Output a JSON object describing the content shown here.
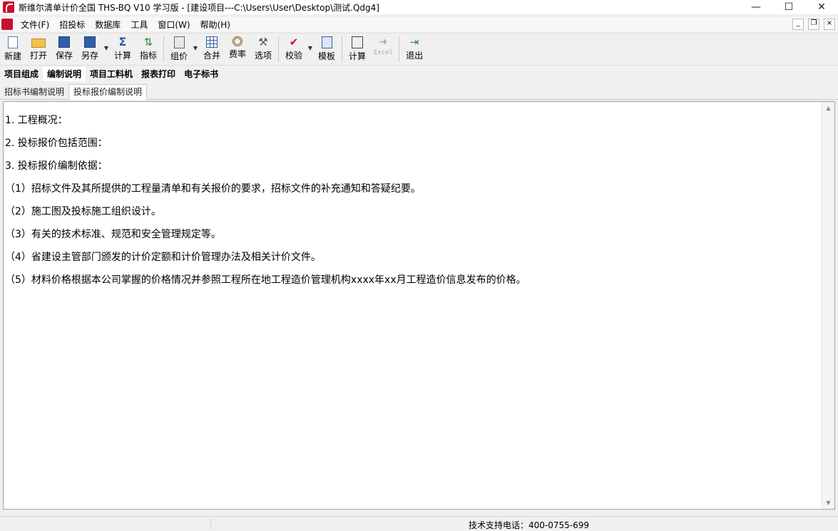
{
  "window": {
    "title": "斯维尔清单计价全国 THS-BQ V10 学习版 - [建设项目---C:\\Users\\User\\Desktop\\测试.Qdg4]",
    "minimize": "—",
    "maximize": "☐",
    "close": "✕"
  },
  "menu": {
    "items": [
      "文件(F)",
      "招投标",
      "数据库",
      "工具",
      "窗口(W)",
      "帮助(H)"
    ],
    "mdi_minimize": "_",
    "mdi_restore": "❐",
    "mdi_close": "×"
  },
  "toolbar": {
    "new": "新建",
    "open": "打开",
    "save": "保存",
    "save_as": "另存",
    "calc": "计算",
    "index": "指标",
    "group_price": "组价",
    "merge": "合并",
    "fee_rate": "费率",
    "options": "选项",
    "verify": "校验",
    "template": "模板",
    "calc2": "计算",
    "excel": "Excel",
    "exit": "退出",
    "dropdown_glyph": "▼"
  },
  "main_tabs": [
    "项目组成",
    "编制说明",
    "项目工料机",
    "报表打印",
    "电子标书"
  ],
  "main_tab_active": 1,
  "sub_tabs": [
    "招标书编制说明",
    "投标报价编制说明"
  ],
  "sub_tab_active": 1,
  "content": {
    "lines": [
      "1. 工程概况：",
      "2. 投标报价包括范围：",
      "3. 投标报价编制依据：",
      "（1）招标文件及其所提供的工程量清单和有关报价的要求，招标文件的补充通知和答疑纪要。",
      "（2）施工图及投标施工组织设计。",
      "（3）有关的技术标准、规范和安全管理规定等。",
      "（4）省建设主管部门颁发的计价定额和计价管理办法及相关计价文件。",
      "（5）材料价格根据本公司掌握的价格情况并参照工程所在地工程造价管理机构xxxx年xx月工程造价信息发布的价格。"
    ]
  },
  "scroll": {
    "up": "▲",
    "down": "▼"
  },
  "status": {
    "support": "技术支持电话：400-0755-699"
  }
}
